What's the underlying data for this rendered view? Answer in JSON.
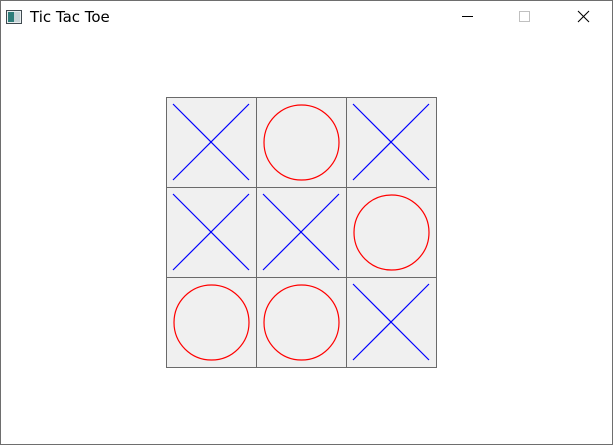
{
  "window": {
    "title": "Tic Tac Toe",
    "icon": "application-icon",
    "controls": [
      "minimize-icon",
      "maximize-icon",
      "close-icon"
    ]
  },
  "board": {
    "rows": 3,
    "cols": 3,
    "cells": [
      [
        "X",
        "O",
        "X"
      ],
      [
        "X",
        "X",
        "O"
      ],
      [
        "O",
        "O",
        "X"
      ]
    ],
    "colors": {
      "x": "#0000ff",
      "o": "#ff0000",
      "cell_bg": "#f0f0f0",
      "grid": "#6a6a6a"
    }
  }
}
